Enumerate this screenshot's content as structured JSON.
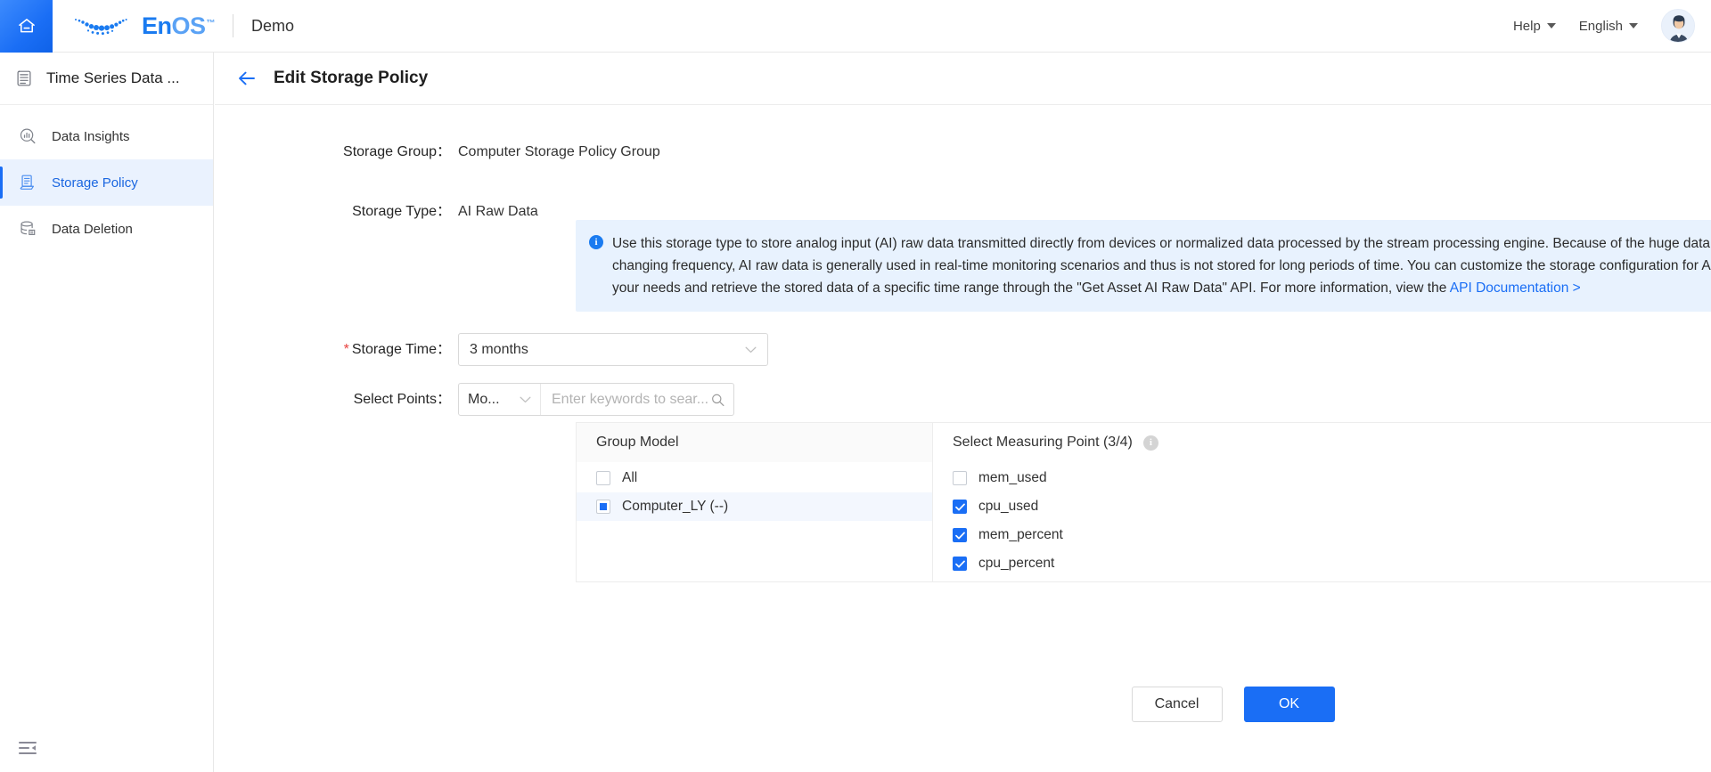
{
  "topbar": {
    "home_icon": "home-icon",
    "brand_en": "En",
    "brand_os": "OS",
    "brand_tm": "™",
    "tenant": "Demo",
    "help_label": "Help",
    "language_label": "English",
    "avatar_icon": "user-avatar"
  },
  "sidebar": {
    "title": "Time Series Data ...",
    "title_icon": "time-series-data-icon",
    "items": [
      {
        "label": "Data Insights",
        "icon": "data-insights-icon",
        "active": false
      },
      {
        "label": "Storage Policy",
        "icon": "storage-policy-icon",
        "active": true
      },
      {
        "label": "Data Deletion",
        "icon": "data-deletion-icon",
        "active": false
      }
    ],
    "collapse_icon": "menu-collapse-icon"
  },
  "page": {
    "back_icon": "back-arrow-icon",
    "title": "Edit Storage Policy"
  },
  "form": {
    "storage_group_label": "Storage Group：",
    "storage_group_value": "Computer Storage Policy Group",
    "storage_type_label": "Storage Type：",
    "storage_type_value": "AI Raw Data",
    "banner": {
      "icon": "info-circle-icon",
      "text": "Use this storage type to store analog input (AI) raw data transmitted directly from devices or normalized data processed by the stream processing engine. Because of the huge data amount and high changing frequency, AI raw data is generally used in real-time monitoring scenarios and thus is not stored for long periods of time. You can customize the storage configuration for AI raw data according to your needs and retrieve the stored data of a specific time range through the \"Get Asset AI Raw Data\" API. For more information, view the ",
      "link_text": "API Documentation >"
    },
    "storage_time_required": "*",
    "storage_time_label": "Storage Time：",
    "storage_time_value": "3 months",
    "select_points_label": "Select Points：",
    "points_scope_value": "Mo...",
    "search_placeholder": "Enter keywords to sear...",
    "search_value": "",
    "search_icon": "search-icon"
  },
  "transfer": {
    "left_header": "Group Model",
    "right_header": "Select Measuring Point (3/4)",
    "right_help_icon": "info-help-icon",
    "left_items": [
      {
        "label": "All",
        "state": "unchecked",
        "selected": false
      },
      {
        "label": "Computer_LY (--)",
        "state": "indeterminate",
        "selected": true
      }
    ],
    "right_items": [
      {
        "label": "mem_used",
        "state": "unchecked"
      },
      {
        "label": "cpu_used",
        "state": "checked"
      },
      {
        "label": "mem_percent",
        "state": "checked"
      },
      {
        "label": "cpu_percent",
        "state": "checked"
      }
    ]
  },
  "footer": {
    "cancel_label": "Cancel",
    "ok_label": "OK"
  },
  "colors": {
    "accent": "#1a6ef5",
    "banner_bg": "#e8f2fe",
    "active_bg": "#eaf2fe",
    "required": "#e8423f"
  }
}
